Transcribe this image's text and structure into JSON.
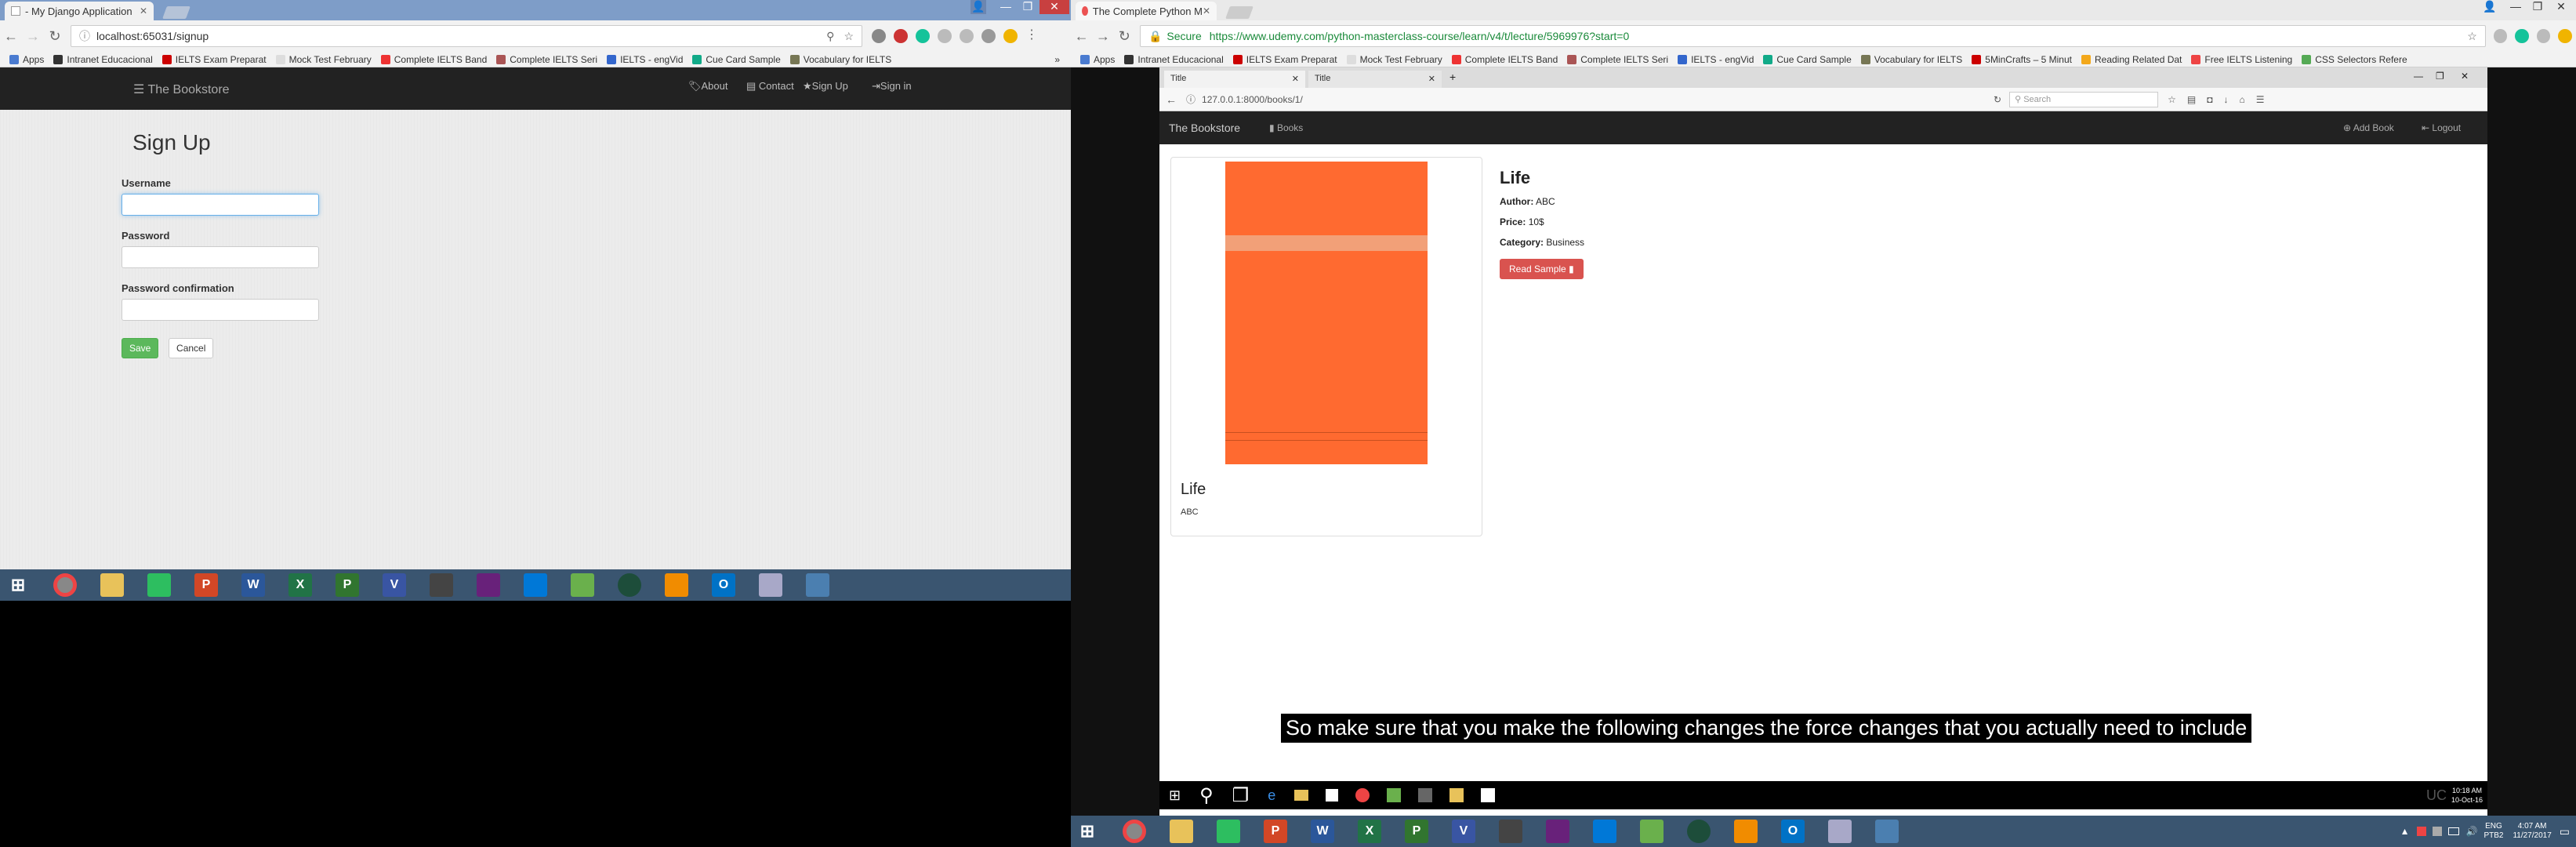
{
  "screen1": {
    "browser": {
      "tab_title": "- My Django Application",
      "url": "localhost:65031/signup",
      "apps_label": "Apps",
      "bookmarks": [
        "Intranet Educacional",
        "IELTS Exam Preparat",
        "Mock Test February",
        "Complete IELTS Band",
        "Complete IELTS Seri",
        "IELTS - engVid",
        "Cue Card Sample",
        "Vocabulary for IELTS"
      ]
    },
    "site": {
      "brand": "The Bookstore",
      "nav": [
        "About",
        "Contact",
        "Sign Up",
        "Sign in"
      ]
    },
    "form": {
      "title": "Sign Up",
      "username_label": "Username",
      "password_label": "Password",
      "password_confirm_label": "Password confirmation",
      "save_label": "Save",
      "cancel_label": "Cancel",
      "username_value": "",
      "password_value": "",
      "password_confirm_value": ""
    },
    "taskbar_apps": [
      "chrome",
      "explorer",
      "evernote",
      "powerpoint",
      "word",
      "excel",
      "project",
      "visio",
      "terminal",
      "visual-studio",
      "vscode",
      "greenshot",
      "reader",
      "vlc",
      "outlook",
      "database",
      "python"
    ]
  },
  "screen2": {
    "browser": {
      "tab_title": "The Complete Python M",
      "secure_label": "Secure",
      "url": "https://www.udemy.com/python-masterclass-course/learn/v4/t/lecture/5969976?start=0",
      "apps_label": "Apps",
      "bookmarks": [
        "Intranet Educacional",
        "IELTS Exam Preparat",
        "Mock Test February",
        "Complete IELTS Band",
        "Complete IELTS Seri",
        "IELTS - engVid",
        "Cue Card Sample",
        "Vocabulary for IELTS",
        "5MinCrafts – 5 Minut",
        "Reading Related Dat",
        "Free IELTS Listening",
        "CSS Selectors Refere"
      ]
    },
    "inner_browser": {
      "tabs": [
        "Title",
        "Title"
      ],
      "url": "127.0.0.1:8000/books/1/",
      "search_placeholder": "Search"
    },
    "site": {
      "brand": "The Bookstore",
      "books_label": "Books",
      "add_book_label": "Add Book",
      "logout_label": "Logout"
    },
    "book": {
      "card_title": "Life",
      "card_author": "ABC",
      "title": "Life",
      "author_label": "Author:",
      "author": "ABC",
      "price_label": "Price:",
      "price": "10$",
      "category_label": "Category:",
      "category": "Business",
      "read_sample_label": "Read Sample"
    },
    "caption": "So make sure that you make the following changes the force changes that you actually need to include",
    "inner_clock": {
      "time": "10:18 AM",
      "date": "10-Oct-16"
    },
    "inner_tray_text": "UC",
    "system_tray": {
      "lang": "ENG",
      "locale": "PTB2",
      "time": "4:07 AM",
      "date": "11/27/2017"
    }
  },
  "colors": {
    "navbar": "#222222",
    "save_button": "#5cb85c",
    "read_sample_button": "#d9534f",
    "book_cover": "#ff6a30",
    "taskbar": "#2b4560"
  }
}
